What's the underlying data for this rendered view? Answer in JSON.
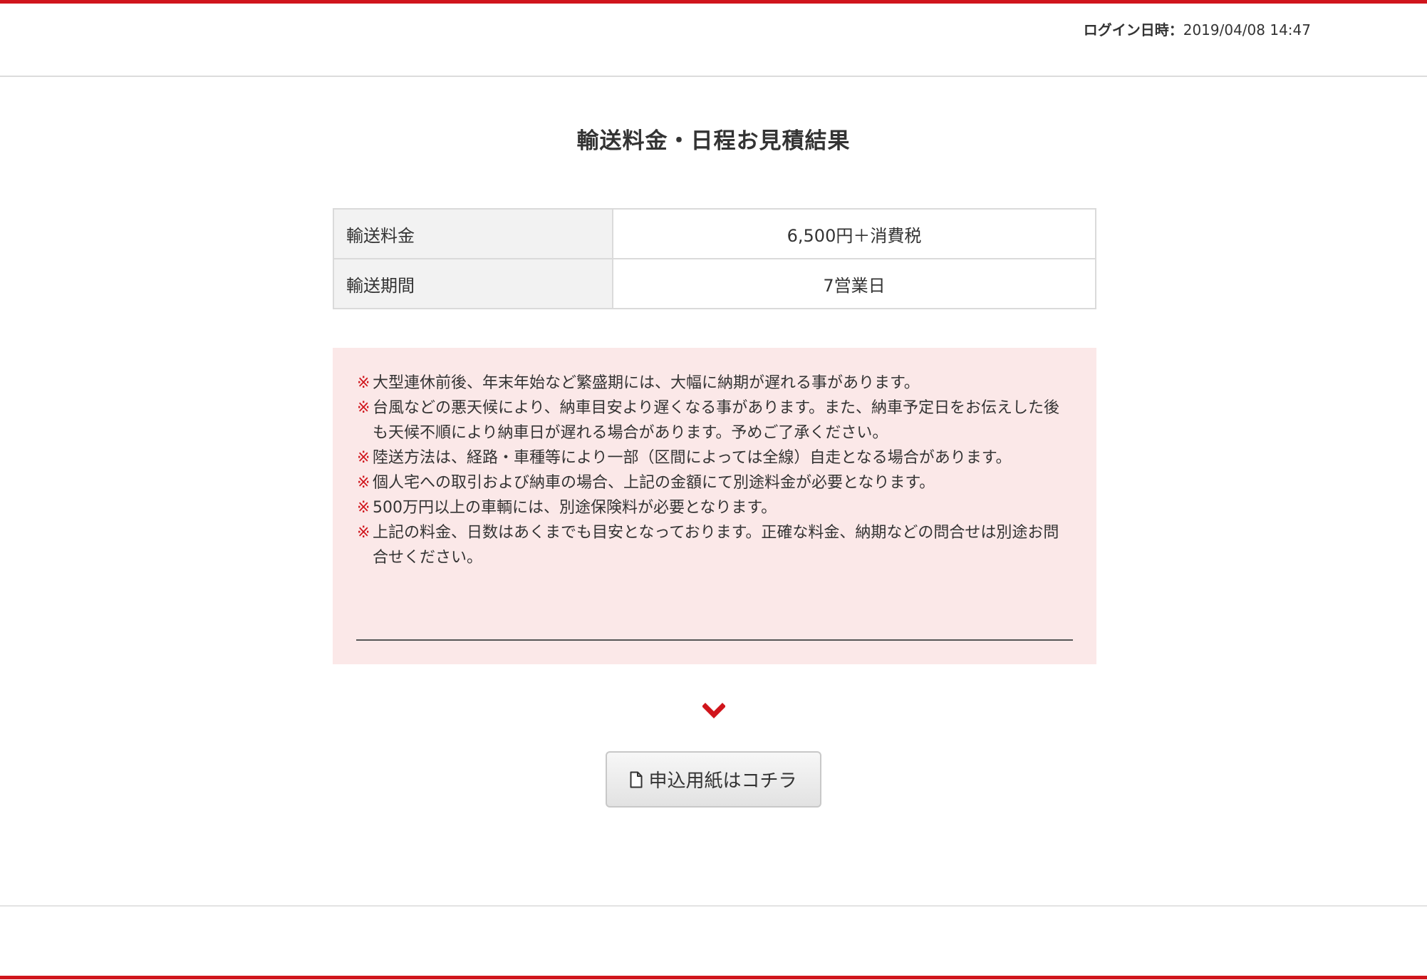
{
  "header": {
    "login_label": "ログイン日時：",
    "login_datetime": "2019/04/08 14:47"
  },
  "page": {
    "title": "輸送料金・日程お見積結果"
  },
  "result_table": {
    "rows": [
      {
        "label": "輸送料金",
        "value": "6,500円＋消費税"
      },
      {
        "label": "輸送期間",
        "value": "7営業日"
      }
    ]
  },
  "notices": {
    "mark": "※",
    "items": [
      "大型連休前後、年末年始など繁盛期には、大幅に納期が遅れる事があります。",
      "台風などの悪天候により、納車目安より遅くなる事があります。また、納車予定日をお伝えした後も天候不順により納車日が遅れる場合があります。予めご了承ください。",
      "陸送方法は、経路・車種等により一部（区間によっては全線）自走となる場合があります。",
      "個人宅への取引および納車の場合、上記の金額にて別途料金が必要となります。",
      "500万円以上の車輌には、別途保険料が必要となります。",
      "上記の料金、日数はあくまでも目安となっております。正確な料金、納期などの問合せは別途お問合せください。"
    ]
  },
  "apply": {
    "button_label": "申込用紙はコチラ",
    "icon": "file-icon"
  },
  "colors": {
    "accent_red": "#d0151c",
    "notice_bg": "#fbe8e8",
    "table_header_bg": "#f2f2f2"
  }
}
